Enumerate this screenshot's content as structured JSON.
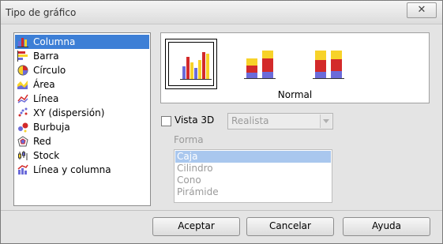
{
  "window": {
    "title": "Tipo de gráfico",
    "close_icon": "x"
  },
  "chart_types": [
    {
      "label": "Columna",
      "icon": "column-chart-icon",
      "selected": true
    },
    {
      "label": "Barra",
      "icon": "bar-chart-icon",
      "selected": false
    },
    {
      "label": "Círculo",
      "icon": "pie-chart-icon",
      "selected": false
    },
    {
      "label": "Área",
      "icon": "area-chart-icon",
      "selected": false
    },
    {
      "label": "Línea",
      "icon": "line-chart-icon",
      "selected": false
    },
    {
      "label": "XY (dispersión)",
      "icon": "scatter-chart-icon",
      "selected": false
    },
    {
      "label": "Burbuja",
      "icon": "bubble-chart-icon",
      "selected": false
    },
    {
      "label": "Red",
      "icon": "net-chart-icon",
      "selected": false
    },
    {
      "label": "Stock",
      "icon": "stock-chart-icon",
      "selected": false
    },
    {
      "label": "Línea y columna",
      "icon": "column-line-chart-icon",
      "selected": false
    }
  ],
  "variants": {
    "selected_label": "Normal",
    "items": [
      {
        "name": "normal",
        "selected": true
      },
      {
        "name": "stacked",
        "selected": false
      },
      {
        "name": "percent-stacked",
        "selected": false
      }
    ]
  },
  "view3d": {
    "label": "Vista 3D",
    "checked": false,
    "scheme_value": "Realista"
  },
  "shape": {
    "label": "Forma",
    "items": [
      "Caja",
      "Cilindro",
      "Cono",
      "Pirámide"
    ],
    "selected": "Caja"
  },
  "buttons": {
    "ok": "Aceptar",
    "cancel": "Cancelar",
    "help": "Ayuda"
  },
  "colors": {
    "selection": "#3d7fd6",
    "red": "#d32a2a",
    "yellow": "#f7d229",
    "blue": "#6b6bd9"
  }
}
